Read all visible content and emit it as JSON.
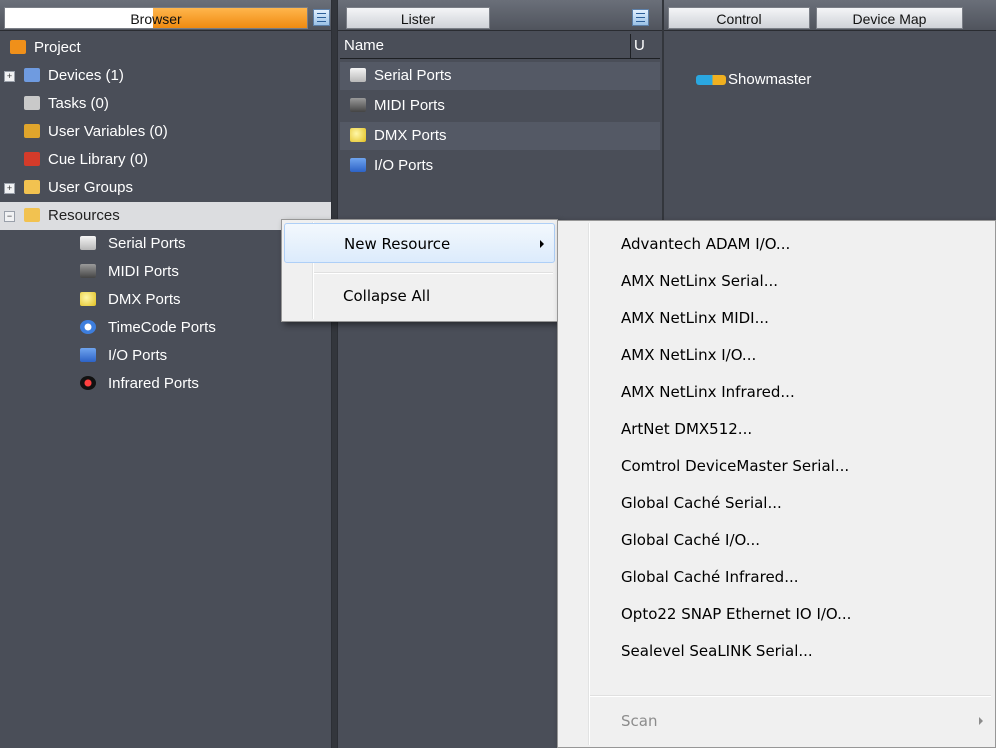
{
  "browser": {
    "tab_label": "Browser",
    "tree": [
      {
        "label": "Project",
        "icon": "project-icon",
        "color": "#f0901a"
      },
      {
        "label": "Devices (1)",
        "icon": "devices-icon",
        "color": "#6f9be0",
        "expander": "+"
      },
      {
        "label": "Tasks (0)",
        "icon": "tasks-icon",
        "color": "#c9c9c9"
      },
      {
        "label": "User Variables (0)",
        "icon": "variables-icon",
        "color": "#e0a52c"
      },
      {
        "label": "Cue Library (0)",
        "icon": "cue-library-icon",
        "color": "#d43b2a"
      },
      {
        "label": "User Groups",
        "icon": "folder-icon",
        "color": "#f2c250",
        "expander": "+"
      },
      {
        "label": "Resources",
        "icon": "folder-icon",
        "color": "#f2c250",
        "expander": "−",
        "selected": true
      },
      {
        "label": "Serial Ports",
        "icon": "serial-port-icon"
      },
      {
        "label": "MIDI Ports",
        "icon": "midi-port-icon"
      },
      {
        "label": "DMX Ports",
        "icon": "dmx-port-icon"
      },
      {
        "label": "TimeCode Ports",
        "icon": "timecode-icon"
      },
      {
        "label": "I/O Ports",
        "icon": "io-port-icon"
      },
      {
        "label": "Infrared Ports",
        "icon": "infrared-icon"
      }
    ]
  },
  "lister": {
    "tab_label": "Lister",
    "columns": [
      "Name",
      "U"
    ],
    "rows": [
      {
        "label": "Serial Ports",
        "icon": "serial-port-icon"
      },
      {
        "label": "MIDI Ports",
        "icon": "midi-port-icon"
      },
      {
        "label": "DMX Ports",
        "icon": "dmx-port-icon"
      },
      {
        "label": "I/O Ports",
        "icon": "io-port-icon"
      }
    ]
  },
  "control": {
    "tabs": [
      "Control",
      "Device Map"
    ],
    "device": {
      "label": "Showmaster",
      "icon": "showmaster-icon"
    }
  },
  "context_menu": {
    "items": [
      {
        "label": "New Resource",
        "has_submenu": true,
        "highlighted": true
      },
      {
        "label": "Collapse All"
      }
    ]
  },
  "submenu": {
    "items": [
      "Advantech ADAM I/O...",
      "AMX NetLinx Serial...",
      "AMX NetLinx MIDI...",
      "AMX NetLinx I/O...",
      "AMX NetLinx Infrared...",
      "ArtNet DMX512...",
      "Comtrol DeviceMaster Serial...",
      "Global Caché Serial...",
      "Global Caché I/O...",
      "Global Caché Infrared...",
      "Opto22 SNAP Ethernet IO I/O...",
      "Sealevel SeaLINK Serial..."
    ],
    "scan_label": "Scan"
  }
}
